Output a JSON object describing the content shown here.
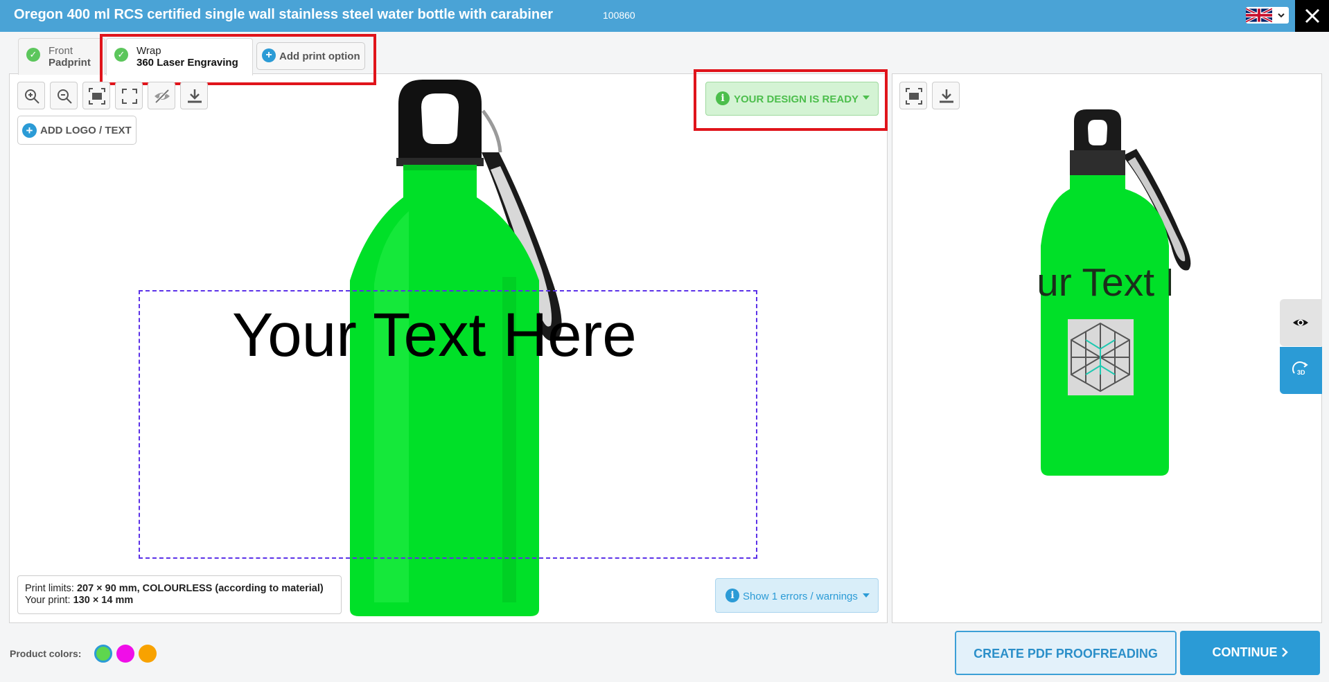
{
  "header": {
    "title": "Oregon 400 ml RCS certified single wall stainless steel water bottle with carabiner",
    "product_code": "100860",
    "language_icon": "uk-flag-icon",
    "close_icon": "close-icon"
  },
  "tabs": [
    {
      "line1": "Front",
      "line2": "Padprint",
      "status_icon": "check-icon"
    },
    {
      "line1": "Wrap",
      "line2": "360 Laser Engraving",
      "status_icon": "check-icon"
    }
  ],
  "add_print_option": {
    "label": "Add print option",
    "icon": "plus-icon"
  },
  "toolbar": {
    "tools": [
      "zoom-in-icon",
      "zoom-out-icon",
      "fit-icon",
      "fullscreen-icon",
      "hide-icon",
      "download-icon"
    ]
  },
  "add_logo": {
    "label": "ADD LOGO / TEXT",
    "icon": "plus-icon"
  },
  "design_status": {
    "label": "YOUR DESIGN IS READY",
    "icon": "info-icon"
  },
  "canvas": {
    "text": "Your Text Here"
  },
  "preview": {
    "text": "ur Text He"
  },
  "print_info": {
    "limits_label": "Print limits:",
    "limits_value": "207 × 90 mm, COLOURLESS (according to material)",
    "your_print_label": "Your print:",
    "your_print_value": "130 × 14 mm"
  },
  "warnings": {
    "label": "Show 1 errors / warnings",
    "icon": "info-icon"
  },
  "side_buttons": [
    "eye-icon",
    "3d-rotate-icon"
  ],
  "side_3d_label": "3D",
  "product_colors": {
    "label": "Product colors:",
    "swatches": [
      "#5ed64e",
      "#f00ee8",
      "#f8a200"
    ]
  },
  "footer": {
    "pdf_button": "CREATE PDF PROOFREADING",
    "continue_button": "CONTINUE"
  },
  "colors": {
    "accent": "#2b9bd6",
    "header": "#4aa3d6",
    "success": "#4cbe4c",
    "highlight": "#e0141b",
    "bottle": "#00e028"
  }
}
